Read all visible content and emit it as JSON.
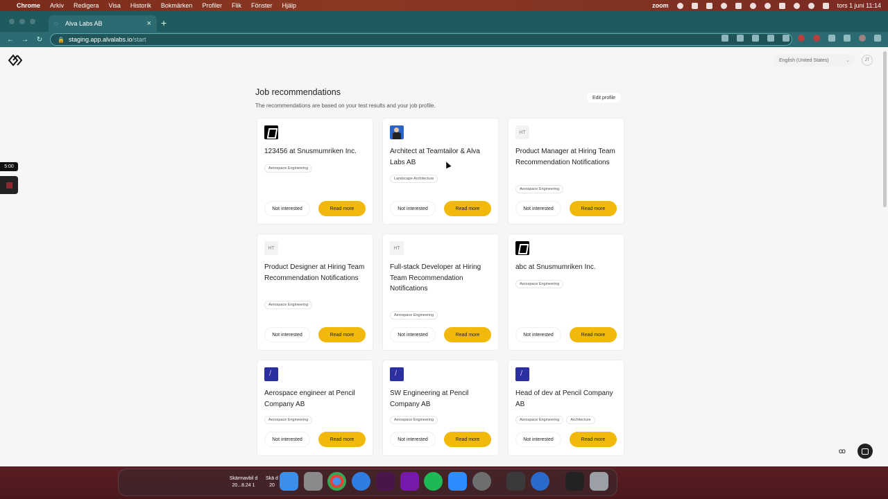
{
  "menubar": {
    "app": "Chrome",
    "items": [
      "Arkiv",
      "Redigera",
      "Visa",
      "Historik",
      "Bokmärken",
      "Profiler",
      "Flik",
      "Fönster",
      "Hjälp"
    ],
    "zoom_label": "zoom",
    "clock": "tors 1 juni 11:14"
  },
  "browser": {
    "tab_title": "Alva Labs AB",
    "url_host": "staging.app.alvalabs.io",
    "url_path": "/start"
  },
  "header": {
    "language": "English (United States)",
    "user_initials": "JT"
  },
  "main": {
    "title": "Job recommendations",
    "subtitle": "The recommendations are based on your test results and your job profile.",
    "edit_profile_label": "Edit profile",
    "not_interested_label": "Not interested",
    "read_more_label": "Read more",
    "jobs": [
      {
        "title": "123456 at Snusmumriken Inc.",
        "logo": "snusmumriken-logo",
        "tags": [
          "Aerospace Engineering"
        ]
      },
      {
        "title": "Architect at Teamtailor & Alva Labs AB",
        "logo": "teamtailor-logo",
        "tags": [
          "Landscape Architecture"
        ]
      },
      {
        "title": "Product Manager at Hiring Team Recommendation Notifications",
        "logo": "HT",
        "tags": [
          "Aerospace Engineering"
        ]
      },
      {
        "title": "Product Designer at Hiring Team Recommendation Notifications",
        "logo": "HT",
        "tags": [
          "Aerospace Engineering"
        ]
      },
      {
        "title": "Full-stack Developer at Hiring Team Recommendation Notifications",
        "logo": "HT",
        "tags": [
          "Aerospace Engineering"
        ]
      },
      {
        "title": "abc at Snusmumriken Inc.",
        "logo": "snusmumriken-logo",
        "tags": [
          "Aerospace Engineering"
        ]
      },
      {
        "title": "Aerospace engineer at Pencil Company AB",
        "logo": "pencil-logo",
        "tags": [
          "Aerospace Engineering"
        ]
      },
      {
        "title": "SW Engineering at Pencil Company AB",
        "logo": "pencil-logo",
        "tags": [
          "Aerospace Engineering"
        ]
      },
      {
        "title": "Head of dev at Pencil Company AB",
        "logo": "pencil-logo",
        "tags": [
          "Aerospace Engineering",
          "Architecture"
        ]
      }
    ]
  },
  "recorder": {
    "timer": "5:00"
  },
  "dock": {
    "stack_label_1": "Skärmavbil d 20...8.24 1",
    "stack_label_2": "Skä d 20"
  },
  "colors": {
    "accent": "#f0b90b",
    "page_bg": "#f6f6f4",
    "chrome_bar": "#2b6b71"
  }
}
